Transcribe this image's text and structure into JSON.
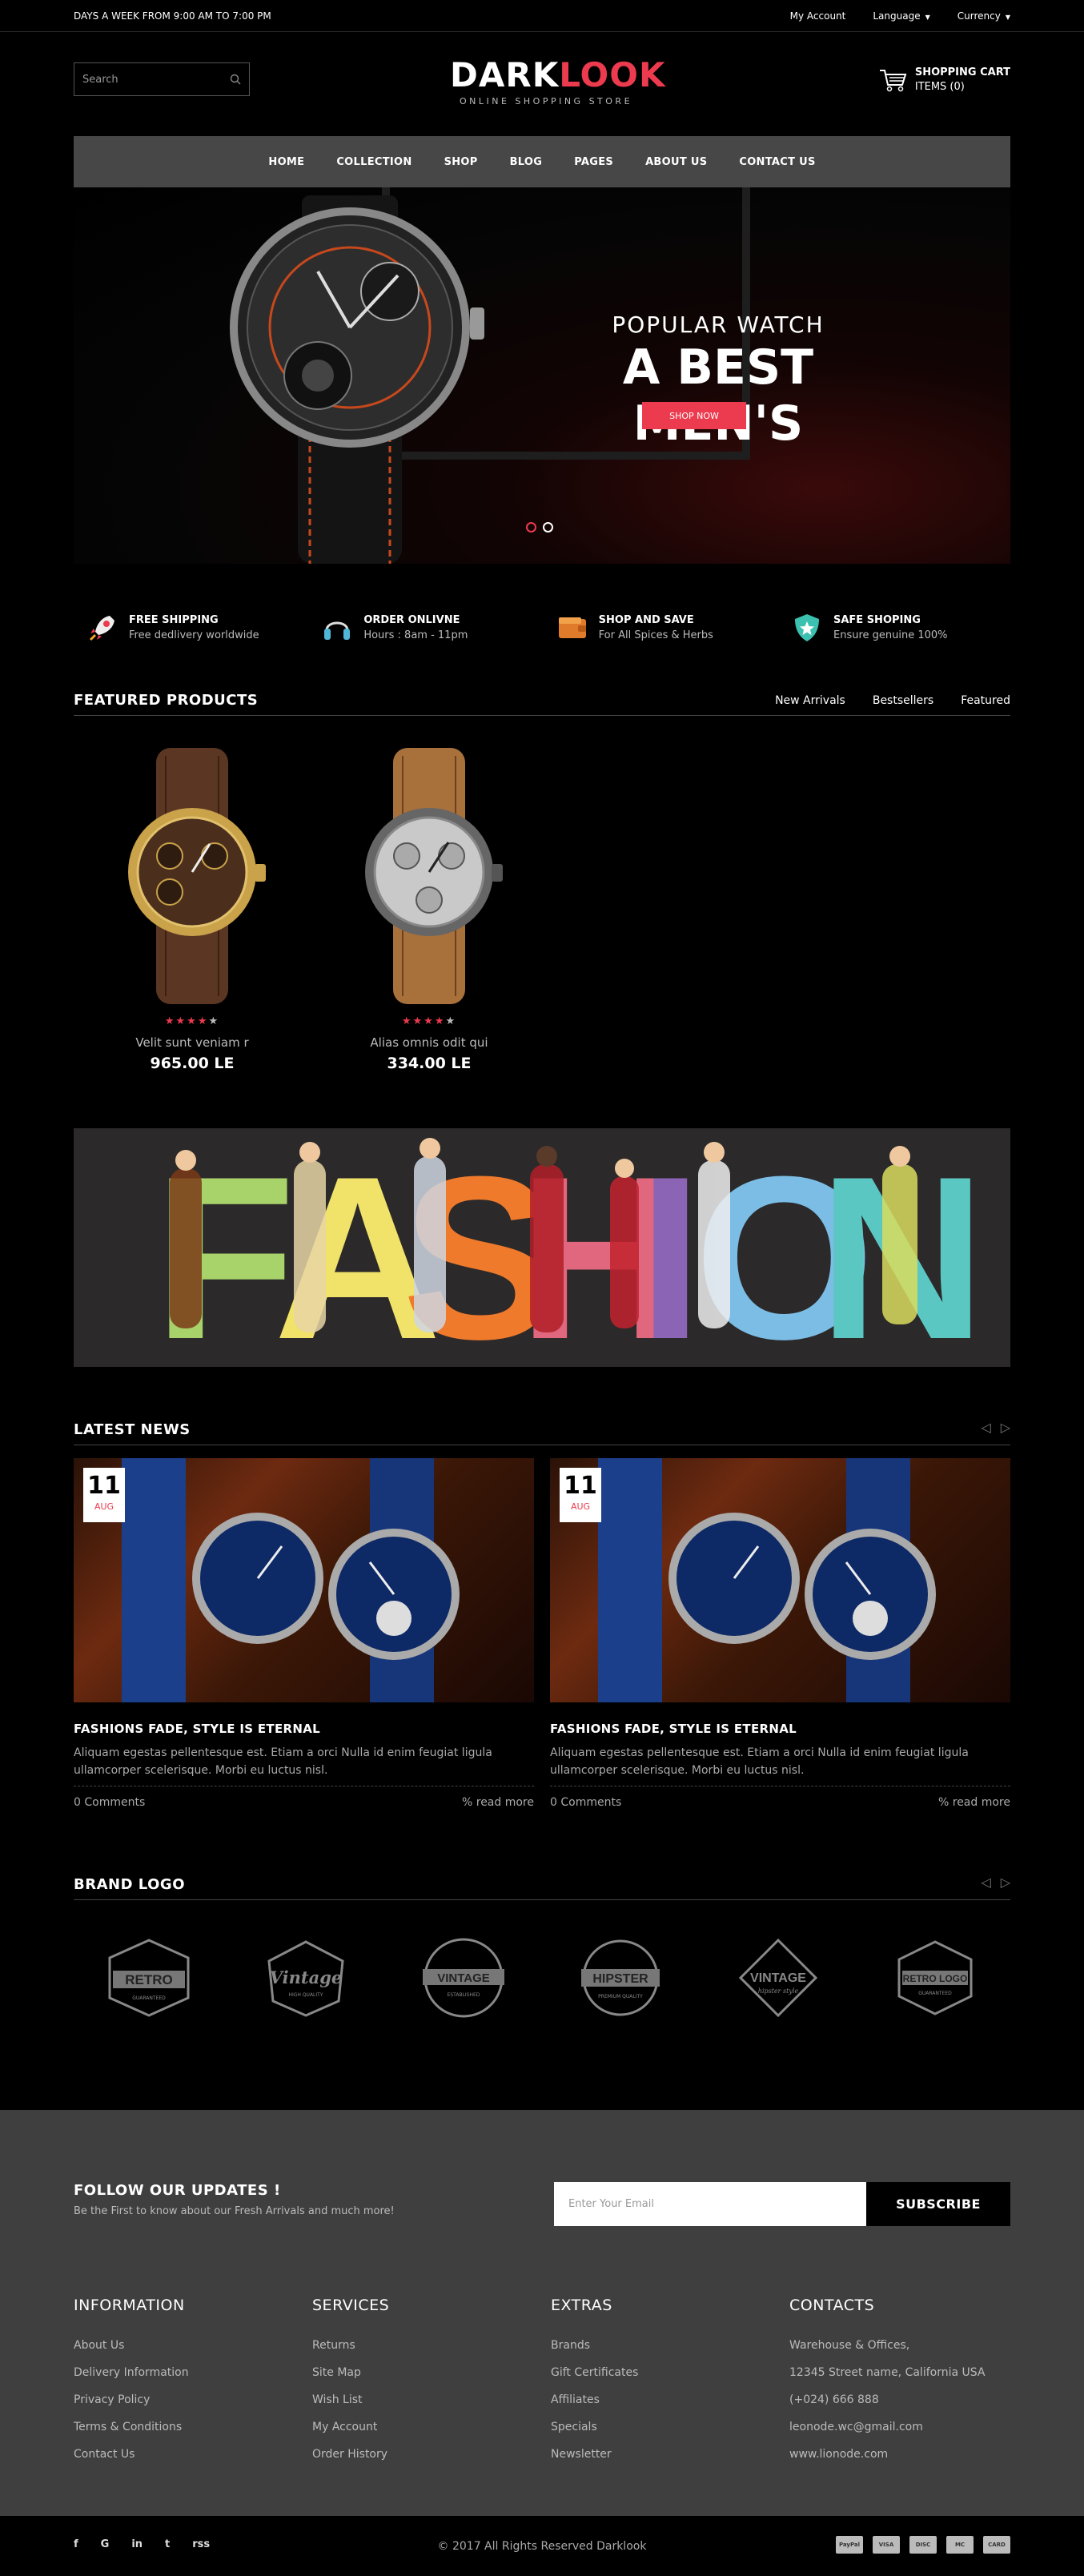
{
  "topbar": {
    "hours": "DAYS A WEEK FROM 9:00 AM TO 7:00 PM",
    "my_account": "My Account",
    "language": "Language",
    "currency": "Currency"
  },
  "header": {
    "search_placeholder": "Search",
    "logo_dark": "DARK",
    "logo_look": "LOOK",
    "logo_tagline": "ONLINE SHOPPING STORE",
    "cart_title": "SHOPPING CART",
    "cart_items": "ITEMS (0)"
  },
  "nav": [
    "HOME",
    "COLLECTION",
    "SHOP",
    "BLOG",
    "PAGES",
    "ABOUT US",
    "CONTACT US"
  ],
  "hero": {
    "kicker": "POPULAR WATCH",
    "title": "A BEST MEN'S",
    "button": "SHOP NOW",
    "slides": 2,
    "active_slide": 1
  },
  "features": [
    {
      "icon": "rocket-icon",
      "title": "FREE SHIPPING",
      "subtitle": "Free dedlivery worldwide"
    },
    {
      "icon": "headphones-icon",
      "title": "ORDER ONLIVNE",
      "subtitle": "Hours : 8am - 11pm"
    },
    {
      "icon": "wallet-icon",
      "title": "SHOP AND SAVE",
      "subtitle": "For All Spices & Herbs"
    },
    {
      "icon": "shield-icon",
      "title": "SAFE SHOPING",
      "subtitle": "Ensure genuine 100%"
    }
  ],
  "featured": {
    "title": "FEATURED PRODUCTS",
    "tabs": [
      "New Arrivals",
      "Bestsellers",
      "Featured"
    ],
    "products": [
      {
        "name": "Velit sunt veniam r",
        "price": "965.00 LE",
        "rating": 4,
        "max_rating": 5
      },
      {
        "name": "Alias omnis odit qui",
        "price": "334.00 LE",
        "rating": 4,
        "max_rating": 5
      }
    ]
  },
  "fashion_banner": {
    "letters": [
      "F",
      "A",
      "S",
      "H",
      "I",
      "O",
      "N"
    ],
    "colors": [
      "#a8d36b",
      "#f1e36a",
      "#ef7a2c",
      "#e0677d",
      "#8c64b6",
      "#7bbde5",
      "#5bc7c2"
    ]
  },
  "news": {
    "title": "LATEST NEWS",
    "items": [
      {
        "day": "11",
        "month": "AUG",
        "title": "FASHIONS FADE, STYLE IS ETERNAL",
        "excerpt": "Aliquam egestas pellentesque est. Etiam a orci Nulla id enim feugiat ligula ullamcorper scelerisque. Morbi eu luctus nisl.",
        "comments": "0 Comments",
        "more": "read more"
      },
      {
        "day": "11",
        "month": "AUG",
        "title": "FASHIONS FADE, STYLE IS ETERNAL",
        "excerpt": "Aliquam egestas pellentesque est. Etiam a orci Nulla id enim feugiat ligula ullamcorper scelerisque. Morbi eu luctus nisl.",
        "comments": "0 Comments",
        "more": "read more"
      }
    ]
  },
  "brands": {
    "title": "BRAND LOGO",
    "items": [
      {
        "name": "RETRO",
        "sub": "GUARANTEED"
      },
      {
        "name": "Vintage",
        "sub": "HIGH QUALITY"
      },
      {
        "name": "VINTAGE",
        "sub": "ESTABLISHED"
      },
      {
        "name": "HIPSTER",
        "sub": "PREMIUM QUALITY"
      },
      {
        "name": "VINTAGE",
        "sub": "hipster style"
      },
      {
        "name": "RETRO LOGO",
        "sub": "GUARANTEED"
      }
    ]
  },
  "footer": {
    "follow_title": "FOLLOW OUR UPDATES !",
    "follow_text": "Be the First to know about our Fresh Arrivals and much more!",
    "email_placeholder": "Enter Your Email",
    "subscribe": "SUBSCRIBE",
    "columns": [
      {
        "title": "INFORMATION",
        "links": [
          "About Us",
          "Delivery Information",
          "Privacy Policy",
          "Terms & Conditions",
          "Contact Us"
        ]
      },
      {
        "title": "SERVICES",
        "links": [
          "Returns",
          "Site Map",
          "Wish List",
          "My Account",
          "Order History"
        ]
      },
      {
        "title": "EXTRAS",
        "links": [
          "Brands",
          "Gift Certificates",
          "Affiliates",
          "Specials",
          "Newsletter"
        ]
      },
      {
        "title": "CONTACTS",
        "links": [
          "Warehouse & Offices,",
          "12345 Street name, California USA",
          "(+024) 666 888",
          "leonode.wc@gmail.com",
          "www.lionode.com"
        ]
      }
    ],
    "social": [
      "f",
      "G",
      "in",
      "t",
      "rss"
    ],
    "copyright": "© 2017 All Rights Reserved Darklook",
    "payments": [
      "PayPal",
      "VISA",
      "DISC",
      "MC",
      "CARD"
    ]
  }
}
